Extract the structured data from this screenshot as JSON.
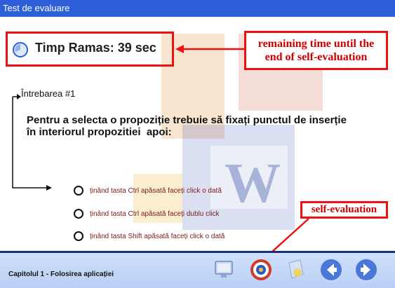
{
  "window": {
    "title": "Test de evaluare"
  },
  "timer": {
    "text": "Timp Ramas: 39 sec"
  },
  "annotations": {
    "timer_note_line1": "remaining time until the",
    "timer_note_line2": "end of self-evaluation",
    "self_eval_note": "self-evaluation"
  },
  "question": {
    "label": "Întrebarea #1",
    "text_line1": "Pentru a selecta o propoziție trebuie să fixați punctul de inserție",
    "text_line2": "în interiorul propozitiei",
    "text_tail": "apoi:"
  },
  "options": [
    {
      "text": "ținând tasta Ctrl apăsată faceți click o dată"
    },
    {
      "text": "ținând tasta Ctrl apăsată faceți dublu click"
    },
    {
      "text": "ținând tasta Shift apăsată faceți click o dată"
    }
  ],
  "footer": {
    "chapter": "Capitolul 1 - Folosirea aplicației"
  },
  "colors": {
    "titlebar": "#2e5fd8",
    "annotation": "#e11111",
    "bottom_border": "#1a2f7a"
  },
  "icons": [
    "clock-icon",
    "monitor-icon",
    "target-icon",
    "help-icon",
    "back-arrow-icon",
    "forward-arrow-icon"
  ]
}
